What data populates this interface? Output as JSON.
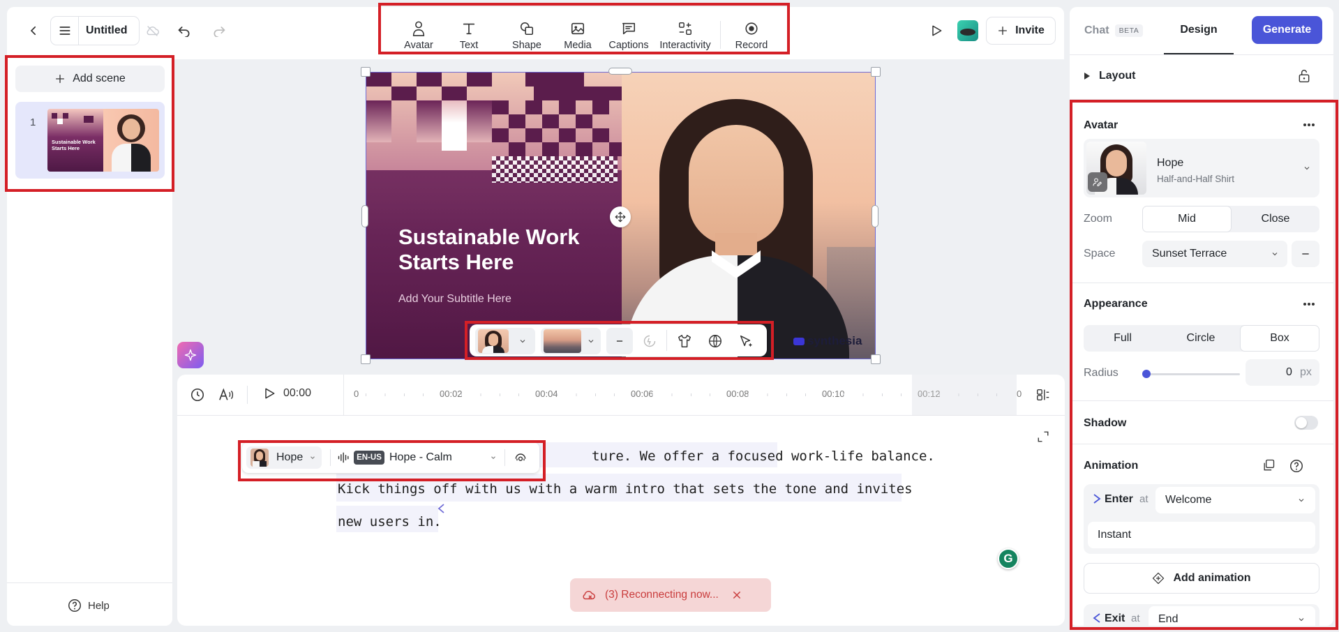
{
  "header": {
    "title": "Untitled",
    "tools": [
      {
        "label": "Avatar",
        "icon": "avatar-icon"
      },
      {
        "label": "Text",
        "icon": "text-icon"
      },
      {
        "label": "Shape",
        "icon": "shape-icon"
      },
      {
        "label": "Media",
        "icon": "media-icon"
      },
      {
        "label": "Captions",
        "icon": "captions-icon"
      },
      {
        "label": "Interactivity",
        "icon": "interactivity-icon"
      },
      {
        "label": "Record",
        "icon": "record-icon"
      }
    ],
    "invite_label": "Invite"
  },
  "sidebar": {
    "add_scene_label": "Add scene",
    "scenes": [
      {
        "number": "1",
        "thumb_title": "Sustainable Work Starts Here"
      }
    ],
    "help_label": "Help"
  },
  "slide": {
    "title_line1": "Sustainable Work",
    "title_line2": "Starts Here",
    "subtitle": "Add Your Subtitle Here",
    "watermark": "synthesia"
  },
  "timeline": {
    "time": "00:00",
    "ticks": [
      "0",
      "00:02",
      "00:04",
      "00:06",
      "00:08",
      "00:10",
      "00:12",
      "0"
    ]
  },
  "script": {
    "avatar_name": "Hope",
    "lang_badge": "EN-US",
    "voice_name": "Hope - Calm",
    "line1_visible": "ture. We offer a focused work-life balance.",
    "line2": "Kick things off with us with a warm intro that sets the tone and invites",
    "line3": "new users in."
  },
  "toast": {
    "text": "(3) Reconnecting now..."
  },
  "rightpanel": {
    "tabs": {
      "chat": "Chat",
      "chat_badge": "BETA",
      "design": "Design"
    },
    "generate_label": "Generate",
    "layout_label": "Layout",
    "avatar_section": "Avatar",
    "avatar_name": "Hope",
    "avatar_outfit": "Half-and-Half Shirt",
    "zoom_label": "Zoom",
    "zoom_options": [
      "Mid",
      "Close"
    ],
    "space_label": "Space",
    "space_value": "Sunset Terrace",
    "appearance_label": "Appearance",
    "appearance_options": [
      "Full",
      "Circle",
      "Box"
    ],
    "radius_label": "Radius",
    "radius_value": "0",
    "radius_unit": "px",
    "radius_fraction": 0,
    "shadow_label": "Shadow",
    "animation_label": "Animation",
    "enter_label": "Enter",
    "at_label": "at",
    "enter_value": "Welcome",
    "enter_style": "Instant",
    "add_animation_label": "Add animation",
    "exit_label": "Exit",
    "exit_value": "End"
  },
  "colors": {
    "accent": "#4a55d8",
    "highlight": "#d41f26",
    "slide_purple": "#5b1d4c"
  }
}
